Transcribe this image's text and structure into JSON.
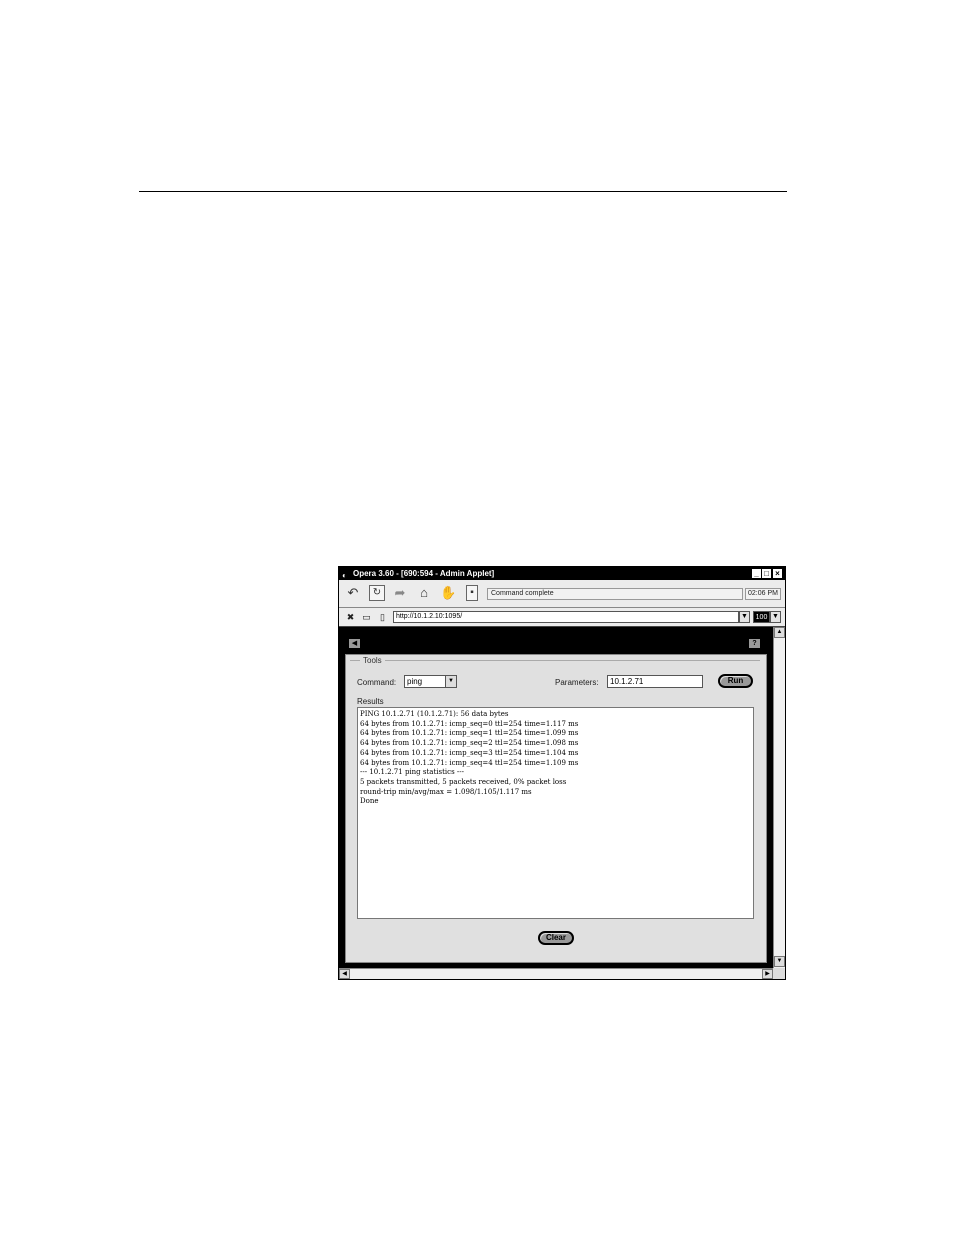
{
  "window": {
    "title": "Opera 3.60 - [690:594 - Admin Applet]",
    "controls": {
      "minimize": "_",
      "maximize": "□",
      "close": "×"
    }
  },
  "toolbar": {
    "status_text": "Command complete",
    "clock": "02:06 PM",
    "icons": [
      "back-icon",
      "reload-icon",
      "forward-icon",
      "home-icon",
      "hotlist-icon",
      "stop-icon"
    ]
  },
  "address": {
    "url": "http://10.1.2.10:1095/",
    "zoom": "100"
  },
  "tools": {
    "group_label": "Tools",
    "command_label": "Command:",
    "command_value": "ping",
    "parameters_label": "Parameters:",
    "parameters_value": "10.1.2.71",
    "run_label": "Run"
  },
  "results": {
    "label": "Results",
    "lines": [
      "PING 10.1.2.71 (10.1.2.71): 56 data bytes",
      "64 bytes from 10.1.2.71: icmp_seq=0 ttl=254 time=1.117 ms",
      "64 bytes from 10.1.2.71: icmp_seq=1 ttl=254 time=1.099 ms",
      "64 bytes from 10.1.2.71: icmp_seq=2 ttl=254 time=1.098 ms",
      "64 bytes from 10.1.2.71: icmp_seq=3 ttl=254 time=1.104 ms",
      "64 bytes from 10.1.2.71: icmp_seq=4 ttl=254 time=1.109 ms",
      "--- 10.1.2.71 ping statistics ---",
      "5 packets transmitted, 5 packets received, 0% packet loss",
      "round-trip min/avg/max = 1.098/1.105/1.117 ms",
      "Done"
    ]
  },
  "clear_label": "Clear"
}
